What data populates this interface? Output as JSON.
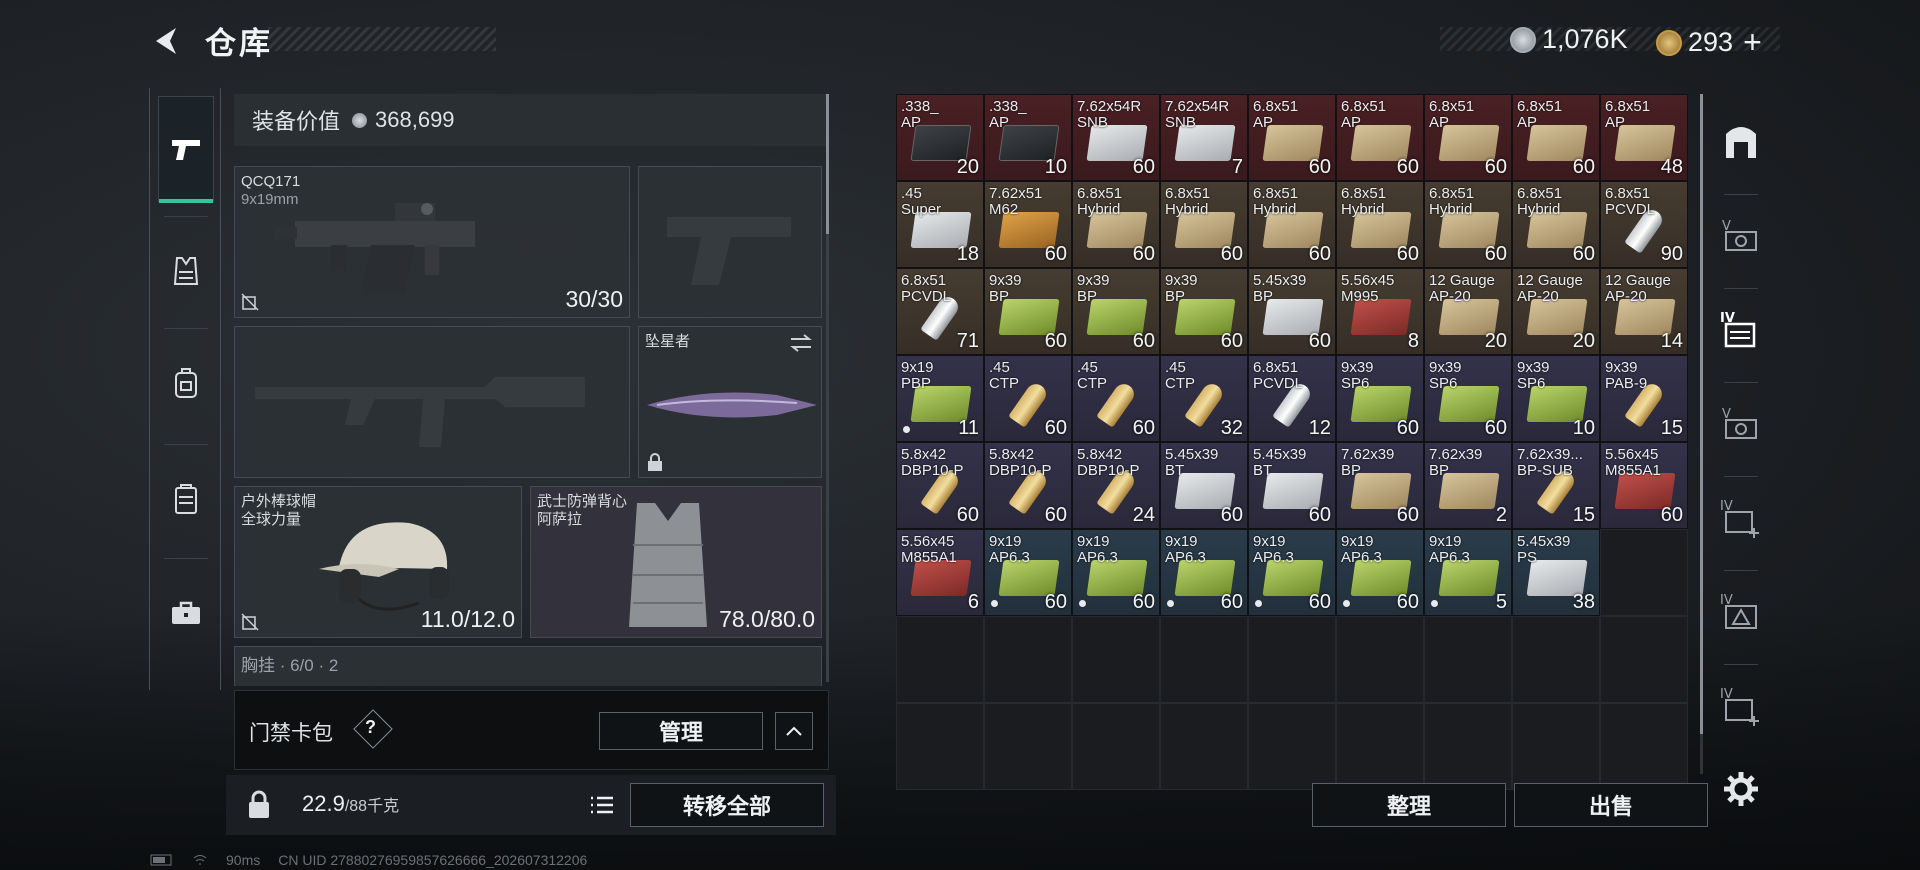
{
  "header": {
    "title": "仓库",
    "silver": "1,076K",
    "gold": "293",
    "plus": "+"
  },
  "equipment": {
    "value_label": "装备价值",
    "value": "368,699",
    "primary": {
      "name": "QCQ171",
      "caliber": "9x19mm",
      "ammo": "30/30"
    },
    "melee": {
      "name": "坠星者"
    },
    "helmet": {
      "name": "户外棒球帽",
      "brand": "全球力量",
      "durability": "11.0/12.0"
    },
    "armor": {
      "name": "武士防弹背心",
      "brand": "阿萨拉",
      "durability": "78.0/80.0"
    },
    "chest_rig": "胸挂 · 6/0 · 2"
  },
  "access_card": {
    "label": "门禁卡包",
    "help": "?",
    "manage": "管理"
  },
  "bottom": {
    "weight": "22.9",
    "weight_max": "/88千克",
    "transfer_all": "转移全部",
    "sort": "整理",
    "sell": "出售"
  },
  "colors": {
    "accent": "#32c5a0",
    "red": "#3a1a1d",
    "brown": "#362e26",
    "purple": "#2a2839",
    "blue": "#22303c"
  },
  "grid": [
    {
      "l1": ".338_",
      "l2": "AP",
      "count": "20",
      "rarity": "red",
      "icon": "ammo-black"
    },
    {
      "l1": ".338_",
      "l2": "AP",
      "count": "10",
      "rarity": "red",
      "icon": "ammo-black"
    },
    {
      "l1": "7.62x54R",
      "l2": "SNB",
      "count": "60",
      "rarity": "red",
      "icon": "ammo-white"
    },
    {
      "l1": "7.62x54R",
      "l2": "SNB",
      "count": "7",
      "rarity": "red",
      "icon": "ammo-white"
    },
    {
      "l1": "6.8x51",
      "l2": "AP",
      "count": "60",
      "rarity": "red",
      "icon": "ammo-tan"
    },
    {
      "l1": "6.8x51",
      "l2": "AP",
      "count": "60",
      "rarity": "red",
      "icon": "ammo-tan"
    },
    {
      "l1": "6.8x51",
      "l2": "AP",
      "count": "60",
      "rarity": "red",
      "icon": "ammo-tan"
    },
    {
      "l1": "6.8x51",
      "l2": "AP",
      "count": "60",
      "rarity": "red",
      "icon": "ammo-tan"
    },
    {
      "l1": "6.8x51",
      "l2": "AP",
      "count": "48",
      "rarity": "red",
      "icon": "ammo-tan"
    },
    {
      "l1": ".45",
      "l2": "Super",
      "count": "18",
      "rarity": "brown",
      "icon": "ammo-white"
    },
    {
      "l1": "7.62x51",
      "l2": "M62",
      "count": "60",
      "rarity": "brown",
      "icon": "ammo-orange"
    },
    {
      "l1": "6.8x51",
      "l2": "Hybrid",
      "count": "60",
      "rarity": "brown",
      "icon": "ammo-tan"
    },
    {
      "l1": "6.8x51",
      "l2": "Hybrid",
      "count": "60",
      "rarity": "brown",
      "icon": "ammo-tan"
    },
    {
      "l1": "6.8x51",
      "l2": "Hybrid",
      "count": "60",
      "rarity": "brown",
      "icon": "ammo-tan"
    },
    {
      "l1": "6.8x51",
      "l2": "Hybrid",
      "count": "60",
      "rarity": "brown",
      "icon": "ammo-tan"
    },
    {
      "l1": "6.8x51",
      "l2": "Hybrid",
      "count": "60",
      "rarity": "brown",
      "icon": "ammo-tan"
    },
    {
      "l1": "6.8x51",
      "l2": "Hybrid",
      "count": "60",
      "rarity": "brown",
      "icon": "ammo-tan"
    },
    {
      "l1": "6.8x51",
      "l2": "PCVDL",
      "count": "90",
      "rarity": "brown",
      "icon": "round-silver"
    },
    {
      "l1": "6.8x51",
      "l2": "PCVDL",
      "count": "71",
      "rarity": "brown",
      "icon": "round-silver"
    },
    {
      "l1": "9x39",
      "l2": "BP",
      "count": "60",
      "rarity": "brown",
      "icon": "ammo-green"
    },
    {
      "l1": "9x39",
      "l2": "BP",
      "count": "60",
      "rarity": "brown",
      "icon": "ammo-green"
    },
    {
      "l1": "9x39",
      "l2": "BP",
      "count": "60",
      "rarity": "brown",
      "icon": "ammo-green"
    },
    {
      "l1": "5.45x39",
      "l2": "BP",
      "count": "60",
      "rarity": "brown",
      "icon": "ammo-white"
    },
    {
      "l1": "5.56x45",
      "l2": "M995",
      "count": "8",
      "rarity": "brown",
      "icon": "ammo-red"
    },
    {
      "l1": "12 Gauge",
      "l2": "AP-20",
      "count": "20",
      "rarity": "brown",
      "icon": "ammo-tan"
    },
    {
      "l1": "12 Gauge",
      "l2": "AP-20",
      "count": "20",
      "rarity": "brown",
      "icon": "ammo-tan"
    },
    {
      "l1": "12 Gauge",
      "l2": "AP-20",
      "count": "14",
      "rarity": "brown",
      "icon": "ammo-tan"
    },
    {
      "l1": "9x19",
      "l2": "PBP",
      "count": "11",
      "rarity": "purple",
      "icon": "ammo-green",
      "dot": true
    },
    {
      "l1": ".45",
      "l2": "CTP",
      "count": "60",
      "rarity": "purple",
      "icon": "round"
    },
    {
      "l1": ".45",
      "l2": "CTP",
      "count": "60",
      "rarity": "purple",
      "icon": "round"
    },
    {
      "l1": ".45",
      "l2": "CTP",
      "count": "32",
      "rarity": "purple",
      "icon": "round"
    },
    {
      "l1": "6.8x51",
      "l2": "PCVDL",
      "count": "12",
      "rarity": "purple",
      "icon": "round-silver"
    },
    {
      "l1": "9x39",
      "l2": "SP6",
      "count": "60",
      "rarity": "purple",
      "icon": "ammo-green"
    },
    {
      "l1": "9x39",
      "l2": "SP6",
      "count": "60",
      "rarity": "purple",
      "icon": "ammo-green"
    },
    {
      "l1": "9x39",
      "l2": "SP6",
      "count": "10",
      "rarity": "purple",
      "icon": "ammo-green"
    },
    {
      "l1": "9x39",
      "l2": "PAB-9",
      "count": "15",
      "rarity": "purple",
      "icon": "round"
    },
    {
      "l1": "5.8x42",
      "l2": "DBP10-P",
      "count": "60",
      "rarity": "purple",
      "icon": "round"
    },
    {
      "l1": "5.8x42",
      "l2": "DBP10-P",
      "count": "60",
      "rarity": "purple",
      "icon": "round"
    },
    {
      "l1": "5.8x42",
      "l2": "DBP10-P",
      "count": "24",
      "rarity": "purple",
      "icon": "round"
    },
    {
      "l1": "5.45x39",
      "l2": "BT",
      "count": "60",
      "rarity": "purple",
      "icon": "ammo-white"
    },
    {
      "l1": "5.45x39",
      "l2": "BT",
      "count": "60",
      "rarity": "purple",
      "icon": "ammo-white"
    },
    {
      "l1": "7.62x39",
      "l2": "BP",
      "count": "60",
      "rarity": "purple",
      "icon": "ammo-tan"
    },
    {
      "l1": "7.62x39",
      "l2": "BP",
      "count": "2",
      "rarity": "purple",
      "icon": "ammo-tan"
    },
    {
      "l1": "7.62x39...",
      "l2": "BP-SUB",
      "count": "15",
      "rarity": "purple",
      "icon": "round"
    },
    {
      "l1": "5.56x45",
      "l2": "M855A1",
      "count": "60",
      "rarity": "purple",
      "icon": "ammo-red"
    },
    {
      "l1": "5.56x45",
      "l2": "M855A1",
      "count": "6",
      "rarity": "purple",
      "icon": "ammo-red"
    },
    {
      "l1": "9x19",
      "l2": "AP6.3",
      "count": "60",
      "rarity": "blue",
      "icon": "ammo-green",
      "dot": true
    },
    {
      "l1": "9x19",
      "l2": "AP6.3",
      "count": "60",
      "rarity": "blue",
      "icon": "ammo-green",
      "dot": true
    },
    {
      "l1": "9x19",
      "l2": "AP6.3",
      "count": "60",
      "rarity": "blue",
      "icon": "ammo-green",
      "dot": true
    },
    {
      "l1": "9x19",
      "l2": "AP6.3",
      "count": "60",
      "rarity": "blue",
      "icon": "ammo-green",
      "dot": true
    },
    {
      "l1": "9x19",
      "l2": "AP6.3",
      "count": "60",
      "rarity": "blue",
      "icon": "ammo-green",
      "dot": true
    },
    {
      "l1": "9x19",
      "l2": "AP6.3",
      "count": "5",
      "rarity": "blue",
      "icon": "ammo-green",
      "dot": true
    },
    {
      "l1": "5.45x39",
      "l2": "PS",
      "count": "38",
      "rarity": "blue",
      "icon": "ammo-white"
    }
  ],
  "status": {
    "ping": "90ms",
    "uid": "CN UID 27880276959857626666_202607312206"
  }
}
